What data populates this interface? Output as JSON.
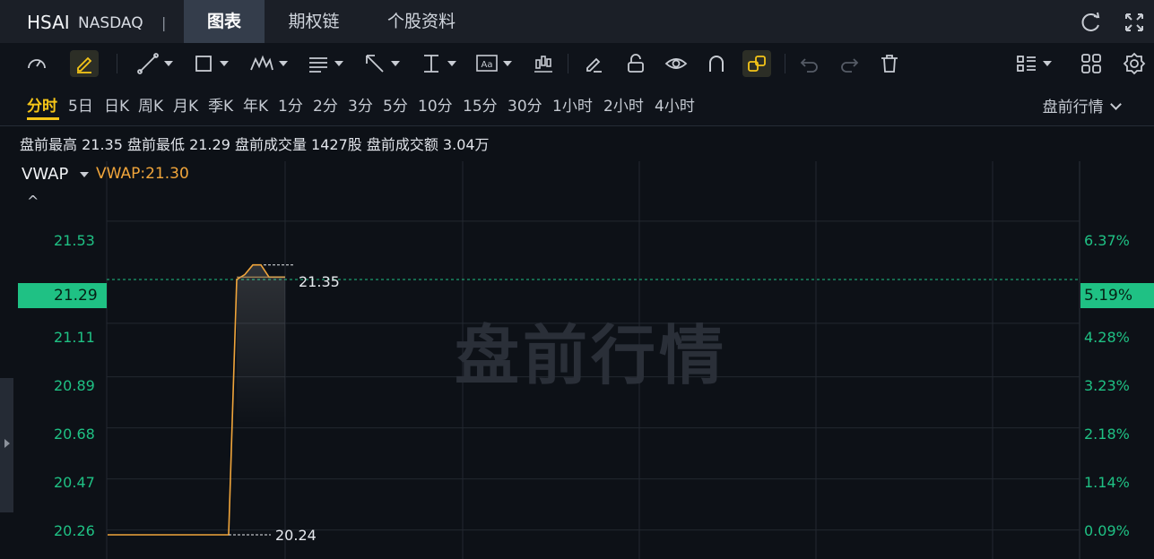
{
  "header": {
    "symbol": "HSAI",
    "exchange": "NASDAQ",
    "separator": "|",
    "tabs": [
      {
        "label": "图表",
        "active": true
      },
      {
        "label": "期权链",
        "active": false
      },
      {
        "label": "个股资料",
        "active": false
      }
    ],
    "icons": [
      "refresh-icon",
      "fullscreen-icon"
    ]
  },
  "toolbar": {
    "tools": [
      "speedometer-icon",
      "pencil-icon",
      "trendline-icon",
      "rectangle-icon",
      "wave-pattern-icon",
      "fibonacci-icon",
      "arrow-icon",
      "measure-icon",
      "text-icon",
      "candlestick-icon",
      "eraser-icon",
      "lock-icon",
      "eye-icon",
      "magnet-icon",
      "link-icon",
      "undo-icon",
      "redo-icon",
      "trash-icon",
      "list-layout-icon",
      "grid-layout-icon",
      "settings-icon"
    ],
    "text_icon_label": "Aa"
  },
  "periods": {
    "items": [
      "分时",
      "5日",
      "日K",
      "周K",
      "月K",
      "季K",
      "年K",
      "1分",
      "2分",
      "3分",
      "5分",
      "10分",
      "15分",
      "30分",
      "1小时",
      "2小时",
      "4小时"
    ],
    "active": "分时",
    "session_select": "盘前行情"
  },
  "stats": {
    "text": "盘前最高 21.35 盘前最低 21.29 盘前成交量 1427股 盘前成交额 3.04万"
  },
  "indicator": {
    "name": "VWAP",
    "value_text": "VWAP:21.30",
    "collapse_symbol": "^"
  },
  "colors": {
    "price_line": "#f0a53b",
    "axis_label": "#1fc184",
    "current_price_bg": "#1fc184",
    "active_period": "#f5c518",
    "background": "#0d1117"
  },
  "chart_data": {
    "type": "line",
    "watermark": "盘前行情",
    "y_left_ticks": [
      "21.53",
      "21.29",
      "21.11",
      "20.89",
      "20.68",
      "20.47",
      "20.26"
    ],
    "y_right_ticks": [
      "6.37%",
      "5.19%",
      "4.28%",
      "3.23%",
      "2.18%",
      "1.14%",
      "0.09%"
    ],
    "ylim": [
      20.24,
      21.64
    ],
    "current_price": "21.29",
    "current_pct": "5.19%",
    "high_label": "21.35",
    "low_label": "20.24",
    "series": [
      {
        "values": [
          20.24,
          20.24,
          20.24,
          20.24,
          20.24,
          20.24,
          20.24,
          20.24,
          20.24,
          20.24,
          20.24,
          20.24,
          20.24,
          20.24,
          20.24,
          20.24,
          21.29,
          21.31,
          21.35,
          21.35,
          21.3,
          21.3,
          21.3
        ]
      }
    ]
  }
}
